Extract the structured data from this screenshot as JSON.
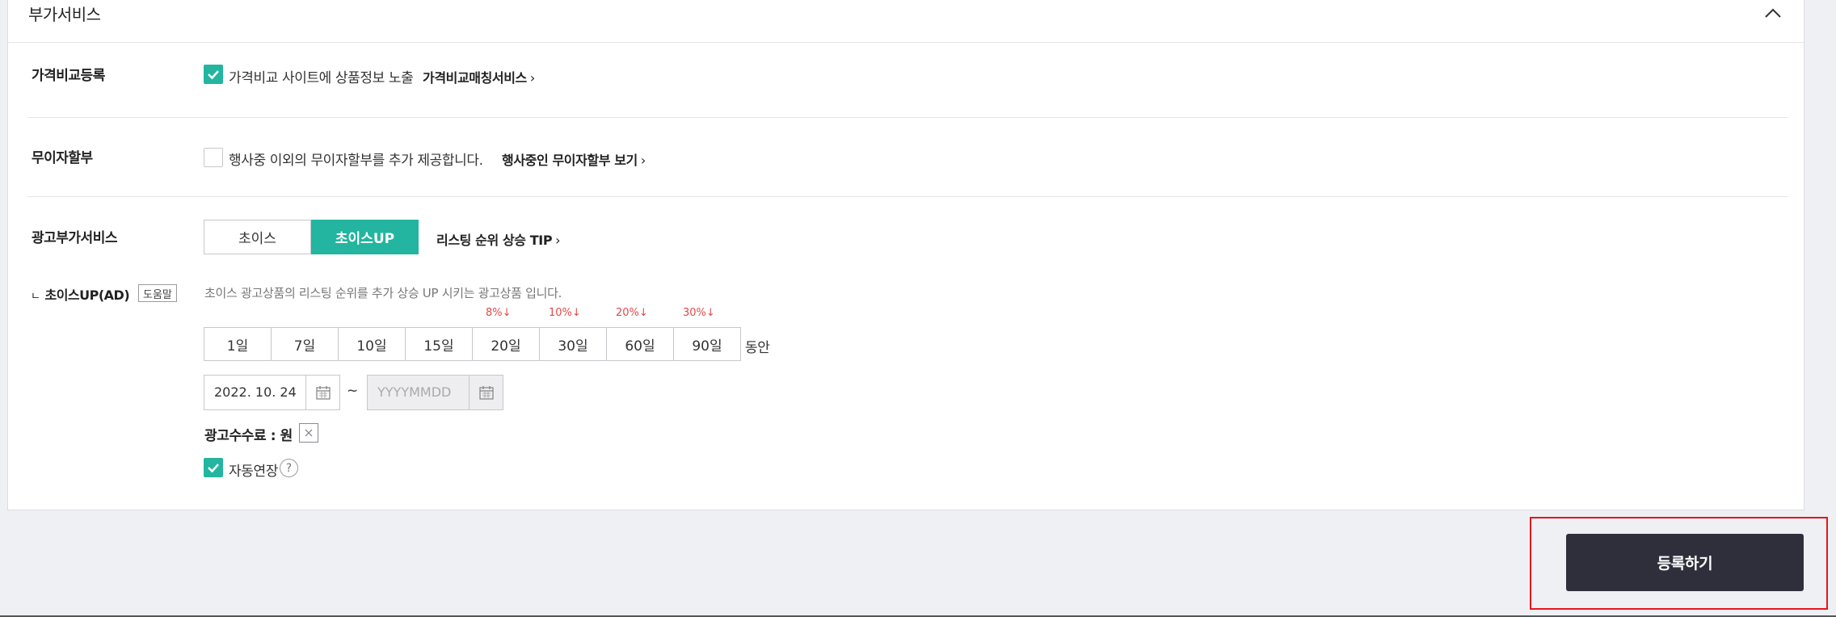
{
  "section": {
    "title": "부가서비스",
    "collapse_icon": "chevron-up-icon"
  },
  "price_compare": {
    "label": "가격비교등록",
    "checked": true,
    "checkbox_text": "가격비교 사이트에 상품정보 노출",
    "link": "가격비교매칭서비스"
  },
  "installment": {
    "label": "무이자할부",
    "checked": false,
    "checkbox_text": "행사중 이외의 무이자할부를 추가 제공합니다.",
    "link": "행사중인 무이자할부 보기"
  },
  "ad_service": {
    "label": "광고부가서비스",
    "options": [
      "초이스",
      "초이스UP"
    ],
    "selected": "초이스UP",
    "tip_link": "리스팅 순위 상승 TIP"
  },
  "choice_up": {
    "prefix": "ㄴ",
    "label": "초이스UP(AD)",
    "help_badge": "도움말",
    "description": "초이스 광고상품의 리스팅 순위를 추가 상승 UP 시키는 광고상품 입니다.",
    "durations": [
      "1일",
      "7일",
      "10일",
      "15일",
      "20일",
      "30일",
      "60일",
      "90일"
    ],
    "discounts": [
      {
        "day": "20일",
        "label": "8%↓"
      },
      {
        "day": "30일",
        "label": "10%↓"
      },
      {
        "day": "60일",
        "label": "20%↓"
      },
      {
        "day": "90일",
        "label": "30%↓"
      }
    ],
    "duration_suffix": "동안",
    "start_date": "2022. 10. 24",
    "range_sep": "~",
    "end_date_placeholder": "YYYYMMDD",
    "fee_label": "광고수수료 : 원",
    "auto_renew_checked": true,
    "auto_renew_label": "자동연장",
    "auto_renew_help": "?"
  },
  "submit": {
    "label": "등록하기"
  },
  "colors": {
    "accent": "#23b5a0",
    "discount": "#e44848",
    "submit_bg": "#2e2f3b",
    "highlight": "#e8141b"
  }
}
